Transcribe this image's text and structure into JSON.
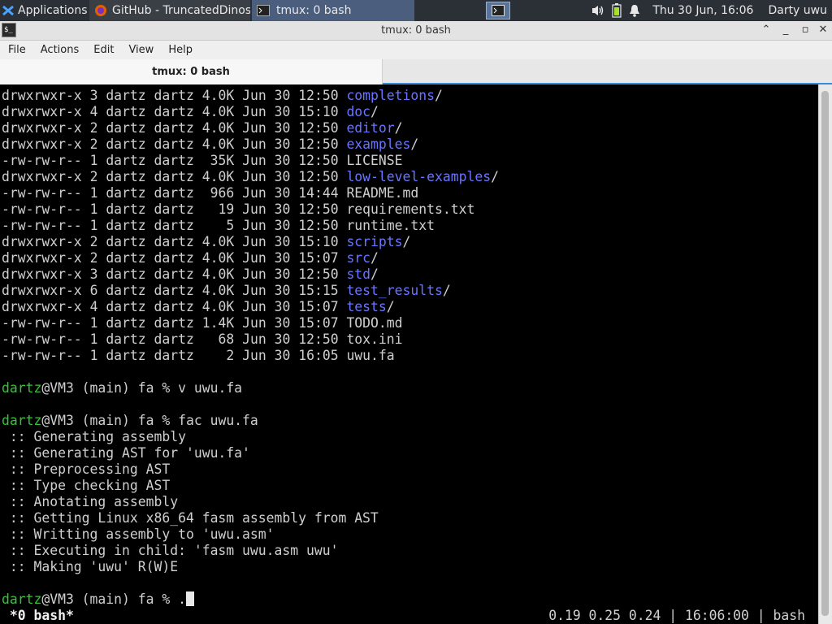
{
  "panel": {
    "applications_label": "Applications",
    "tasks": [
      {
        "label": "GitHub - TruncatedDinos..."
      },
      {
        "label": "tmux: 0 bash"
      }
    ],
    "clock": "Thu 30 Jun, 16:06",
    "user": "Darty uwu"
  },
  "window": {
    "title": "tmux: 0 bash",
    "menu": [
      "File",
      "Actions",
      "Edit",
      "View",
      "Help"
    ],
    "tab_label": "tmux: 0 bash"
  },
  "terminal": {
    "listing": [
      {
        "perm": "drwxrwxr-x",
        "links": "3",
        "owner": "dartz",
        "group": "dartz",
        "size": "4.0K",
        "month": "Jun",
        "day": "30",
        "time": "12:50",
        "name": "completions",
        "is_dir": true
      },
      {
        "perm": "drwxrwxr-x",
        "links": "4",
        "owner": "dartz",
        "group": "dartz",
        "size": "4.0K",
        "month": "Jun",
        "day": "30",
        "time": "15:10",
        "name": "doc",
        "is_dir": true
      },
      {
        "perm": "drwxrwxr-x",
        "links": "2",
        "owner": "dartz",
        "group": "dartz",
        "size": "4.0K",
        "month": "Jun",
        "day": "30",
        "time": "12:50",
        "name": "editor",
        "is_dir": true
      },
      {
        "perm": "drwxrwxr-x",
        "links": "2",
        "owner": "dartz",
        "group": "dartz",
        "size": "4.0K",
        "month": "Jun",
        "day": "30",
        "time": "12:50",
        "name": "examples",
        "is_dir": true
      },
      {
        "perm": "-rw-rw-r--",
        "links": "1",
        "owner": "dartz",
        "group": "dartz",
        "size": "35K",
        "month": "Jun",
        "day": "30",
        "time": "12:50",
        "name": "LICENSE",
        "is_dir": false
      },
      {
        "perm": "drwxrwxr-x",
        "links": "2",
        "owner": "dartz",
        "group": "dartz",
        "size": "4.0K",
        "month": "Jun",
        "day": "30",
        "time": "12:50",
        "name": "low-level-examples",
        "is_dir": true
      },
      {
        "perm": "-rw-rw-r--",
        "links": "1",
        "owner": "dartz",
        "group": "dartz",
        "size": "966",
        "month": "Jun",
        "day": "30",
        "time": "14:44",
        "name": "README.md",
        "is_dir": false
      },
      {
        "perm": "-rw-rw-r--",
        "links": "1",
        "owner": "dartz",
        "group": "dartz",
        "size": "19",
        "month": "Jun",
        "day": "30",
        "time": "12:50",
        "name": "requirements.txt",
        "is_dir": false
      },
      {
        "perm": "-rw-rw-r--",
        "links": "1",
        "owner": "dartz",
        "group": "dartz",
        "size": "5",
        "month": "Jun",
        "day": "30",
        "time": "12:50",
        "name": "runtime.txt",
        "is_dir": false
      },
      {
        "perm": "drwxrwxr-x",
        "links": "2",
        "owner": "dartz",
        "group": "dartz",
        "size": "4.0K",
        "month": "Jun",
        "day": "30",
        "time": "15:10",
        "name": "scripts",
        "is_dir": true
      },
      {
        "perm": "drwxrwxr-x",
        "links": "2",
        "owner": "dartz",
        "group": "dartz",
        "size": "4.0K",
        "month": "Jun",
        "day": "30",
        "time": "15:07",
        "name": "src",
        "is_dir": true
      },
      {
        "perm": "drwxrwxr-x",
        "links": "3",
        "owner": "dartz",
        "group": "dartz",
        "size": "4.0K",
        "month": "Jun",
        "day": "30",
        "time": "12:50",
        "name": "std",
        "is_dir": true
      },
      {
        "perm": "drwxrwxr-x",
        "links": "6",
        "owner": "dartz",
        "group": "dartz",
        "size": "4.0K",
        "month": "Jun",
        "day": "30",
        "time": "15:15",
        "name": "test_results",
        "is_dir": true
      },
      {
        "perm": "drwxrwxr-x",
        "links": "4",
        "owner": "dartz",
        "group": "dartz",
        "size": "4.0K",
        "month": "Jun",
        "day": "30",
        "time": "15:07",
        "name": "tests",
        "is_dir": true
      },
      {
        "perm": "-rw-rw-r--",
        "links": "1",
        "owner": "dartz",
        "group": "dartz",
        "size": "1.4K",
        "month": "Jun",
        "day": "30",
        "time": "15:07",
        "name": "TODO.md",
        "is_dir": false
      },
      {
        "perm": "-rw-rw-r--",
        "links": "1",
        "owner": "dartz",
        "group": "dartz",
        "size": "68",
        "month": "Jun",
        "day": "30",
        "time": "12:50",
        "name": "tox.ini",
        "is_dir": false
      },
      {
        "perm": "-rw-rw-r--",
        "links": "1",
        "owner": "dartz",
        "group": "dartz",
        "size": "2",
        "month": "Jun",
        "day": "30",
        "time": "16:05",
        "name": "uwu.fa",
        "is_dir": false
      }
    ],
    "prompt_user": "dartz",
    "prompt_rest": "@VM3 (main) fa % ",
    "commands": [
      "v uwu.fa",
      "fac uwu.fa",
      "."
    ],
    "compiler_output": [
      " :: Generating assembly",
      " :: Generating AST for 'uwu.fa'",
      " :: Preprocessing AST",
      " :: Type checking AST",
      " :: Anotating assembly",
      " :: Getting Linux x86_64 fasm assembly from AST",
      " :: Writting assembly to 'uwu.asm'",
      " :: Executing in child: 'fasm uwu.asm uwu'",
      " :: Making 'uwu' R(W)E"
    ],
    "status_left": " *0 bash*",
    "status_right": "0.19 0.25 0.24 | 16:06:00 | bash"
  },
  "colors": {
    "directory": "#6a74ff",
    "prompt_user": "#36c536",
    "terminal_bg": "#000000",
    "terminal_fg": "#cfcfcf",
    "panel_bg": "#2b3036",
    "tab_accent": "#3c8bd9"
  },
  "icons": [
    "applications-menu-icon",
    "firefox-icon",
    "terminal-icon",
    "volume-icon",
    "battery-icon",
    "notification-bell-icon",
    "minimize-icon",
    "maximize-icon",
    "close-icon",
    "chevron-up-icon"
  ]
}
